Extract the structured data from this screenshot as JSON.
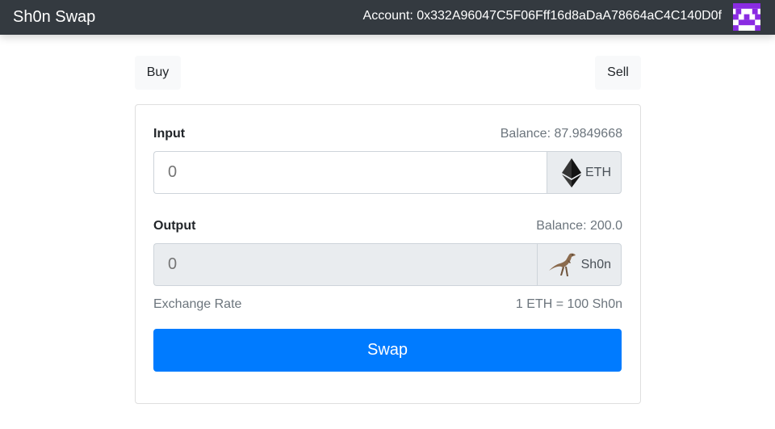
{
  "navbar": {
    "brand": "Sh0n Swap",
    "account_text": "Account: 0x332A96047C5F06Fff16d8aDaA78664aC4C140D0f",
    "identicon_color": "#8a2be2"
  },
  "tabs": {
    "buy_label": "Buy",
    "sell_label": "Sell"
  },
  "form": {
    "input": {
      "label": "Input",
      "balance_text": "Balance: 87.9849668",
      "placeholder": "0",
      "token_label": "ETH",
      "token_icon": "ethereum-icon"
    },
    "output": {
      "label": "Output",
      "balance_text": "Balance: 200.0",
      "placeholder": "0",
      "token_label": "Sh0n",
      "token_icon": "dinosaur-icon"
    },
    "exchange_rate_label": "Exchange Rate",
    "exchange_rate_value": "1 ETH = 100 Sh0n",
    "swap_label": "Swap"
  },
  "colors": {
    "navbar_bg": "#343a40",
    "primary": "#007bff",
    "muted": "#6c757d"
  }
}
